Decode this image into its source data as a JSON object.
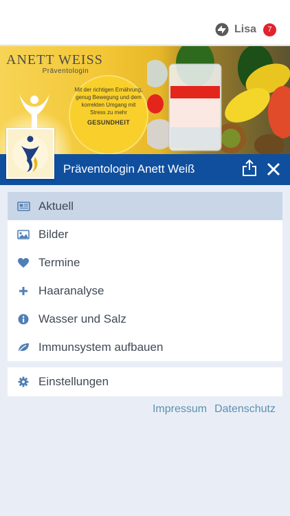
{
  "header": {
    "user_name": "Lisa",
    "badge_count": "7"
  },
  "banner": {
    "brand_name": "ANETT WEISS",
    "brand_subtitle": "Präventologin",
    "slogan_body": "Mit der richtigen Ernährung, genug Bewegung und dem korrekten Umgang mit Stress zu mehr",
    "slogan_title": "GESUNDHEIT"
  },
  "title_bar": {
    "title": "Präventologin Anett Weiß"
  },
  "menu": {
    "items": [
      {
        "label": "Aktuell",
        "icon": "newspaper-icon",
        "active": true
      },
      {
        "label": "Bilder",
        "icon": "image-icon",
        "active": false
      },
      {
        "label": "Termine",
        "icon": "heart-icon",
        "active": false
      },
      {
        "label": "Haaranalyse",
        "icon": "plus-icon",
        "active": false
      },
      {
        "label": "Wasser und Salz",
        "icon": "info-icon",
        "active": false
      },
      {
        "label": "Immunsystem aufbauen",
        "icon": "leaf-icon",
        "active": false
      }
    ],
    "settings_label": "Einstellungen"
  },
  "footer": {
    "impressum": "Impressum",
    "datenschutz": "Datenschutz"
  },
  "colors": {
    "accent_blue": "#0f4f9e",
    "icon_blue": "#4f7fb5",
    "link_blue": "#5d8fb2",
    "active_row": "#c8d6e8",
    "badge_red": "#e0232c"
  }
}
